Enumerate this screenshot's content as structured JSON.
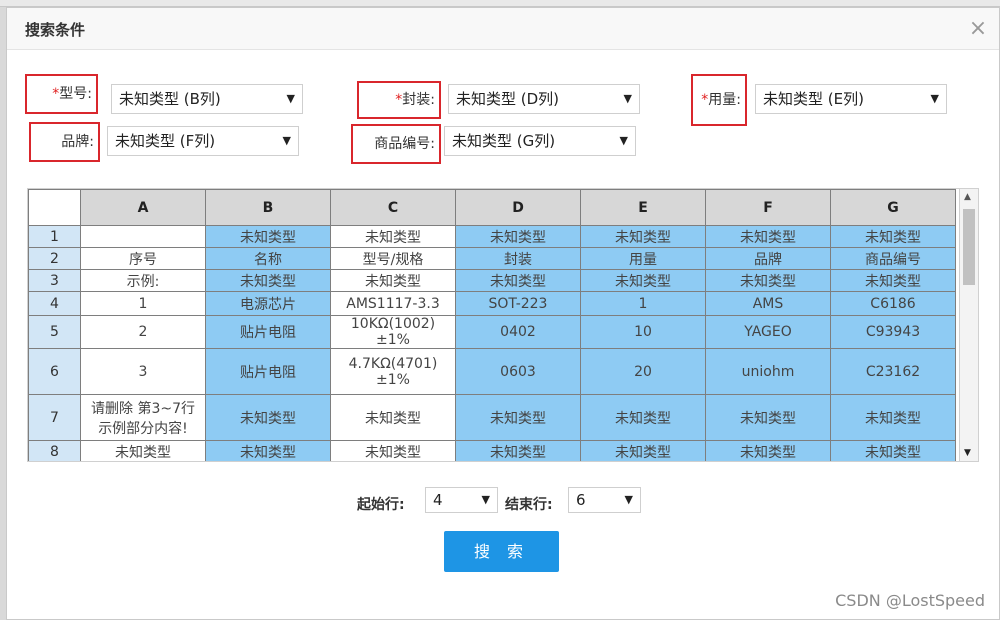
{
  "dialog": {
    "title": "搜索条件",
    "close_symbol": "×"
  },
  "filters": {
    "required_mark": "*",
    "model": {
      "label": "型号:",
      "value": "未知类型 (B列)"
    },
    "package": {
      "label": "封装:",
      "value": "未知类型 (D列)"
    },
    "quantity": {
      "label": "用量:",
      "value": "未知类型 (E列)"
    },
    "brand": {
      "label": "品牌:",
      "value": "未知类型 (F列)"
    },
    "product_code": {
      "label": "商品编号:",
      "value": "未知类型 (G列)"
    }
  },
  "sheet": {
    "columns": [
      "A",
      "B",
      "C",
      "D",
      "E",
      "F",
      "G"
    ],
    "rows": [
      {
        "num": "1",
        "cells": [
          "",
          "未知类型",
          "未知类型",
          "未知类型",
          "未知类型",
          "未知类型",
          "未知类型"
        ]
      },
      {
        "num": "2",
        "cells": [
          "序号",
          "名称",
          "型号/规格",
          "封装",
          "用量",
          "品牌",
          "商品编号"
        ]
      },
      {
        "num": "3",
        "cells": [
          "示例:",
          "未知类型",
          "未知类型",
          "未知类型",
          "未知类型",
          "未知类型",
          "未知类型"
        ]
      },
      {
        "num": "4",
        "cells": [
          "1",
          "电源芯片",
          "AMS1117-3.3",
          "SOT-223",
          "1",
          "AMS",
          "C6186"
        ]
      },
      {
        "num": "5",
        "cells": [
          "2",
          "贴片电阻",
          "10KΩ(1002) ±1%",
          "0402",
          "10",
          "YAGEO",
          "C93943"
        ]
      },
      {
        "num": "6",
        "cells": [
          "3",
          "贴片电阻",
          "4.7KΩ(4701) ±1%",
          "0603",
          "20",
          "uniohm",
          "C23162"
        ]
      },
      {
        "num": "7",
        "cells": [
          "请删除 第3~7行 示例部分内容!",
          "未知类型",
          "未知类型",
          "未知类型",
          "未知类型",
          "未知类型",
          "未知类型"
        ]
      },
      {
        "num": "8",
        "cells": [
          "未知类型",
          "未知类型",
          "未知类型",
          "未知类型",
          "未知类型",
          "未知类型",
          "未知类型"
        ]
      }
    ]
  },
  "range": {
    "start_label": "起始行:",
    "start_value": "4",
    "end_label": "结束行:",
    "end_value": "6"
  },
  "search_button": "搜 索",
  "watermark": "CSDN @LostSpeed",
  "colors": {
    "highlight_blue": "#8ecbf3",
    "header_gray": "#d7d7d7",
    "row_header_blue": "#d2e6f6",
    "required_red": "#e02020",
    "label_box_red": "#d9262c",
    "button_blue": "#1e95e5"
  },
  "icons": {
    "close": "close-icon",
    "dropdown": "caret-down-icon",
    "scroll_up": "scroll-up-icon",
    "scroll_down": "scroll-down-icon"
  }
}
